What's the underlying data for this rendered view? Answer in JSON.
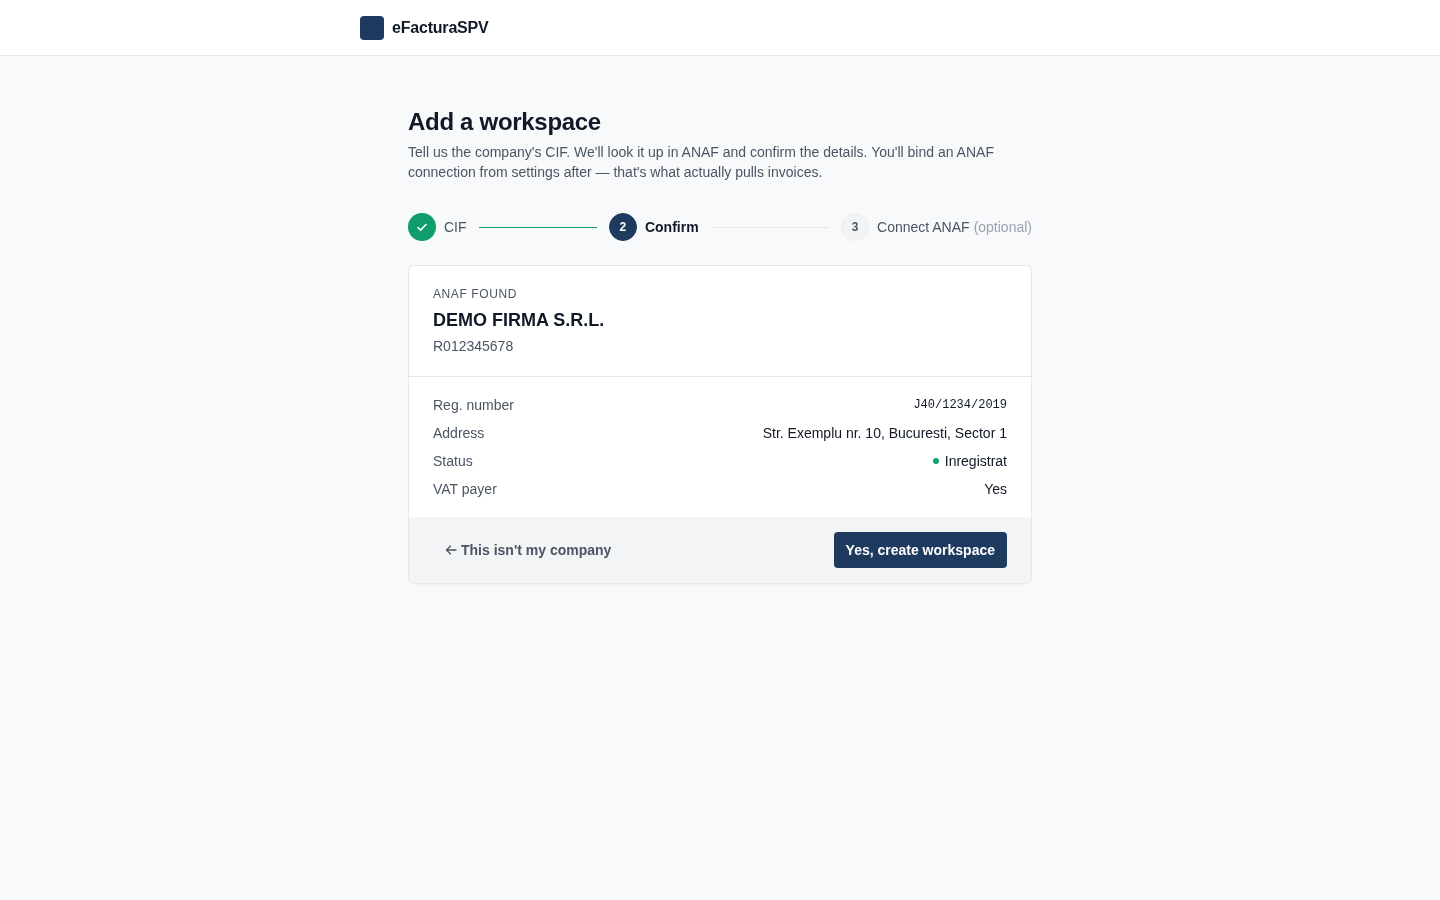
{
  "header": {
    "brand": "eFacturaSPV"
  },
  "page": {
    "title": "Add a workspace",
    "description": "Tell us the company's CIF. We'll look it up in ANAF and confirm the details. You'll bind an ANAF connection from settings after — that's what actually pulls invoices."
  },
  "steps": [
    {
      "label": "CIF",
      "completed": true,
      "selected": false
    },
    {
      "number": "2",
      "label": "Confirm",
      "completed": false,
      "selected": true
    },
    {
      "number": "3",
      "label": "Connect ANAF",
      "note": "(optional)",
      "completed": false,
      "selected": false
    }
  ],
  "card": {
    "eyebrow": "ANAF FOUND",
    "company_name": "DEMO FIRMA S.R.L.",
    "cif": "R012345678",
    "details": [
      {
        "kind": "mono",
        "label": "Reg. number",
        "value": "J40/1234/2019"
      },
      {
        "kind": "text",
        "label": "Address",
        "value": "Str. Exemplu nr. 10, Bucuresti, Sector 1"
      },
      {
        "kind": "status",
        "label": "Status",
        "value": "Inregistrat",
        "color": "#10a36b"
      },
      {
        "kind": "text",
        "label": "VAT payer",
        "value": "Yes"
      }
    ],
    "back_link": "This isn't my company",
    "confirm_button": "Yes, create workspace"
  }
}
